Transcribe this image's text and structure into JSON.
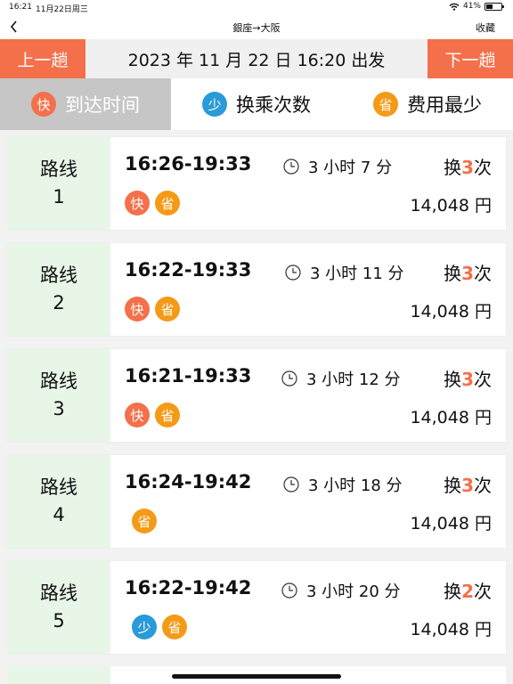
{
  "status": {
    "time": "16:21",
    "date": "11月22日周三",
    "battery": "41%",
    "battery_level": 0.41
  },
  "nav": {
    "title": "銀座→大阪",
    "favorite": "收藏"
  },
  "datebar": {
    "prev": "上一趟",
    "date": "2023 年 11 月 22 日 16:20 出发",
    "next": "下一趟"
  },
  "tabs": [
    {
      "badge": "快",
      "label": "到达时间",
      "active": true
    },
    {
      "badge": "少",
      "label": "换乘次数",
      "active": false
    },
    {
      "badge": "省",
      "label": "费用最少",
      "active": false
    }
  ],
  "routes": [
    {
      "label": "路线",
      "num": "1",
      "times": "16:26-19:33",
      "duration": "3 小时 7 分",
      "transfer_prefix": "换",
      "transfers": "3",
      "transfer_suffix": "次",
      "tags": [
        "快",
        "省"
      ],
      "price": "14,048 円"
    },
    {
      "label": "路线",
      "num": "2",
      "times": "16:22-19:33",
      "duration": "3 小时 11 分",
      "transfer_prefix": "换",
      "transfers": "3",
      "transfer_suffix": "次",
      "tags": [
        "快",
        "省"
      ],
      "price": "14,048 円"
    },
    {
      "label": "路线",
      "num": "3",
      "times": "16:21-19:33",
      "duration": "3 小时 12 分",
      "transfer_prefix": "换",
      "transfers": "3",
      "transfer_suffix": "次",
      "tags": [
        "快",
        "省"
      ],
      "price": "14,048 円"
    },
    {
      "label": "路线",
      "num": "4",
      "times": "16:24-19:42",
      "duration": "3 小时 18 分",
      "transfer_prefix": "换",
      "transfers": "3",
      "transfer_suffix": "次",
      "tags": [
        "省"
      ],
      "price": "14,048 円"
    },
    {
      "label": "路线",
      "num": "5",
      "times": "16:22-19:42",
      "duration": "3 小时 20 分",
      "transfer_prefix": "换",
      "transfers": "2",
      "transfer_suffix": "次",
      "tags": [
        "少",
        "省"
      ],
      "price": "14,048 円"
    }
  ],
  "colors": {
    "accent": "#f4704b",
    "fast": "#f4704b",
    "less": "#2a9ad8",
    "cheap": "#f59a17",
    "route_label_bg": "#e8f6e8"
  },
  "icons": {
    "back": "chevron-left-icon",
    "clock": "clock-icon",
    "wifi": "wifi-icon",
    "battery": "battery-icon"
  }
}
